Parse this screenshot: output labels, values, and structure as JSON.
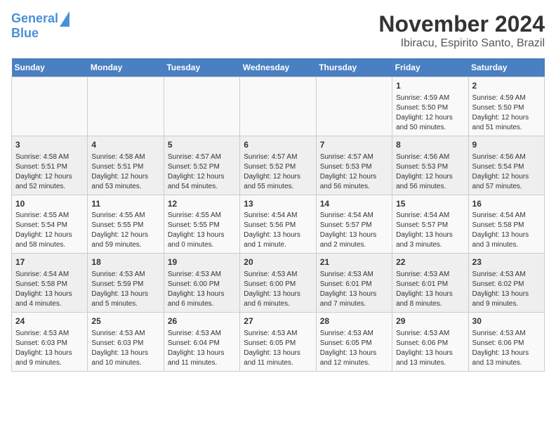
{
  "header": {
    "logo_line1": "General",
    "logo_line2": "Blue",
    "title": "November 2024",
    "subtitle": "Ibiracu, Espirito Santo, Brazil"
  },
  "days_of_week": [
    "Sunday",
    "Monday",
    "Tuesday",
    "Wednesday",
    "Thursday",
    "Friday",
    "Saturday"
  ],
  "weeks": [
    [
      {
        "day": "",
        "info": ""
      },
      {
        "day": "",
        "info": ""
      },
      {
        "day": "",
        "info": ""
      },
      {
        "day": "",
        "info": ""
      },
      {
        "day": "",
        "info": ""
      },
      {
        "day": "1",
        "info": "Sunrise: 4:59 AM\nSunset: 5:50 PM\nDaylight: 12 hours and 50 minutes."
      },
      {
        "day": "2",
        "info": "Sunrise: 4:59 AM\nSunset: 5:50 PM\nDaylight: 12 hours and 51 minutes."
      }
    ],
    [
      {
        "day": "3",
        "info": "Sunrise: 4:58 AM\nSunset: 5:51 PM\nDaylight: 12 hours and 52 minutes."
      },
      {
        "day": "4",
        "info": "Sunrise: 4:58 AM\nSunset: 5:51 PM\nDaylight: 12 hours and 53 minutes."
      },
      {
        "day": "5",
        "info": "Sunrise: 4:57 AM\nSunset: 5:52 PM\nDaylight: 12 hours and 54 minutes."
      },
      {
        "day": "6",
        "info": "Sunrise: 4:57 AM\nSunset: 5:52 PM\nDaylight: 12 hours and 55 minutes."
      },
      {
        "day": "7",
        "info": "Sunrise: 4:57 AM\nSunset: 5:53 PM\nDaylight: 12 hours and 56 minutes."
      },
      {
        "day": "8",
        "info": "Sunrise: 4:56 AM\nSunset: 5:53 PM\nDaylight: 12 hours and 56 minutes."
      },
      {
        "day": "9",
        "info": "Sunrise: 4:56 AM\nSunset: 5:54 PM\nDaylight: 12 hours and 57 minutes."
      }
    ],
    [
      {
        "day": "10",
        "info": "Sunrise: 4:55 AM\nSunset: 5:54 PM\nDaylight: 12 hours and 58 minutes."
      },
      {
        "day": "11",
        "info": "Sunrise: 4:55 AM\nSunset: 5:55 PM\nDaylight: 12 hours and 59 minutes."
      },
      {
        "day": "12",
        "info": "Sunrise: 4:55 AM\nSunset: 5:55 PM\nDaylight: 13 hours and 0 minutes."
      },
      {
        "day": "13",
        "info": "Sunrise: 4:54 AM\nSunset: 5:56 PM\nDaylight: 13 hours and 1 minute."
      },
      {
        "day": "14",
        "info": "Sunrise: 4:54 AM\nSunset: 5:57 PM\nDaylight: 13 hours and 2 minutes."
      },
      {
        "day": "15",
        "info": "Sunrise: 4:54 AM\nSunset: 5:57 PM\nDaylight: 13 hours and 3 minutes."
      },
      {
        "day": "16",
        "info": "Sunrise: 4:54 AM\nSunset: 5:58 PM\nDaylight: 13 hours and 3 minutes."
      }
    ],
    [
      {
        "day": "17",
        "info": "Sunrise: 4:54 AM\nSunset: 5:58 PM\nDaylight: 13 hours and 4 minutes."
      },
      {
        "day": "18",
        "info": "Sunrise: 4:53 AM\nSunset: 5:59 PM\nDaylight: 13 hours and 5 minutes."
      },
      {
        "day": "19",
        "info": "Sunrise: 4:53 AM\nSunset: 6:00 PM\nDaylight: 13 hours and 6 minutes."
      },
      {
        "day": "20",
        "info": "Sunrise: 4:53 AM\nSunset: 6:00 PM\nDaylight: 13 hours and 6 minutes."
      },
      {
        "day": "21",
        "info": "Sunrise: 4:53 AM\nSunset: 6:01 PM\nDaylight: 13 hours and 7 minutes."
      },
      {
        "day": "22",
        "info": "Sunrise: 4:53 AM\nSunset: 6:01 PM\nDaylight: 13 hours and 8 minutes."
      },
      {
        "day": "23",
        "info": "Sunrise: 4:53 AM\nSunset: 6:02 PM\nDaylight: 13 hours and 9 minutes."
      }
    ],
    [
      {
        "day": "24",
        "info": "Sunrise: 4:53 AM\nSunset: 6:03 PM\nDaylight: 13 hours and 9 minutes."
      },
      {
        "day": "25",
        "info": "Sunrise: 4:53 AM\nSunset: 6:03 PM\nDaylight: 13 hours and 10 minutes."
      },
      {
        "day": "26",
        "info": "Sunrise: 4:53 AM\nSunset: 6:04 PM\nDaylight: 13 hours and 11 minutes."
      },
      {
        "day": "27",
        "info": "Sunrise: 4:53 AM\nSunset: 6:05 PM\nDaylight: 13 hours and 11 minutes."
      },
      {
        "day": "28",
        "info": "Sunrise: 4:53 AM\nSunset: 6:05 PM\nDaylight: 13 hours and 12 minutes."
      },
      {
        "day": "29",
        "info": "Sunrise: 4:53 AM\nSunset: 6:06 PM\nDaylight: 13 hours and 13 minutes."
      },
      {
        "day": "30",
        "info": "Sunrise: 4:53 AM\nSunset: 6:06 PM\nDaylight: 13 hours and 13 minutes."
      }
    ]
  ]
}
